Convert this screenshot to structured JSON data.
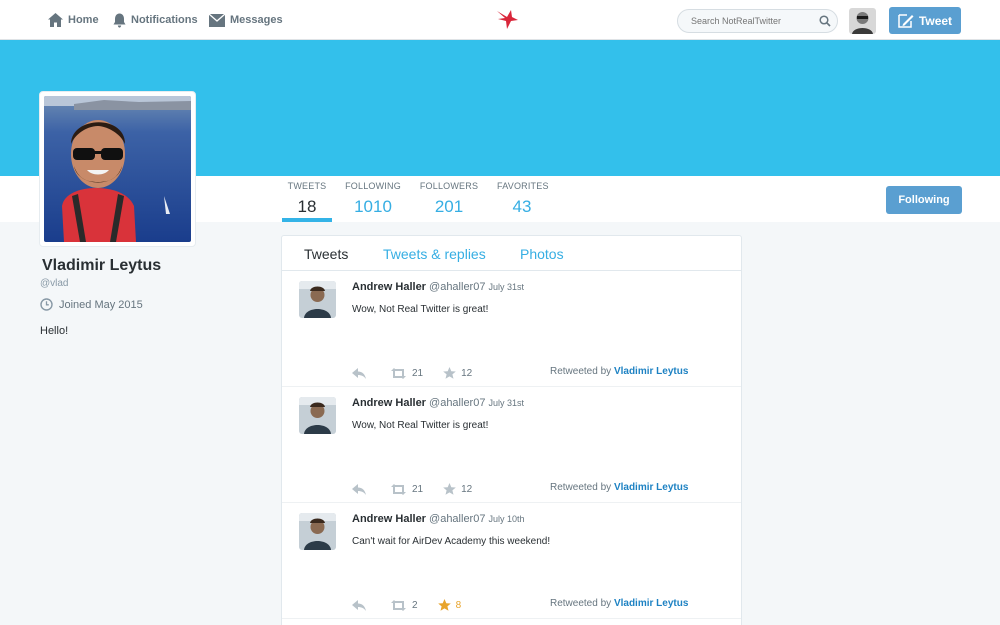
{
  "nav": {
    "home": "Home",
    "notifications": "Notifications",
    "messages": "Messages"
  },
  "search": {
    "placeholder": "Search NotRealTwitter"
  },
  "tweet_button": "Tweet",
  "profile": {
    "name": "Vladimir Leytus",
    "handle": "@vlad",
    "joined": "Joined May 2015",
    "bio": "Hello!"
  },
  "stats": [
    {
      "label": "TWEETS",
      "value": "18"
    },
    {
      "label": "FOLLOWING",
      "value": "1010"
    },
    {
      "label": "FOLLOWERS",
      "value": "201"
    },
    {
      "label": "FAVORITES",
      "value": "43"
    }
  ],
  "following_button": "Following",
  "tabs": [
    "Tweets",
    "Tweets & replies",
    "Photos"
  ],
  "retweeted_by_label": "Retweeted by",
  "tweets": [
    {
      "author": "Andrew Haller",
      "handle": "@ahaller07",
      "date": "July 31st",
      "text": "Wow, Not Real Twitter is great!",
      "retweets": "21",
      "favorites": "12",
      "favorited": false,
      "retweeted_by": "Vladimir Leytus"
    },
    {
      "author": "Andrew Haller",
      "handle": "@ahaller07",
      "date": "July 31st",
      "text": "Wow, Not Real Twitter is great!",
      "retweets": "21",
      "favorites": "12",
      "favorited": false,
      "retweeted_by": "Vladimir Leytus"
    },
    {
      "author": "Andrew Haller",
      "handle": "@ahaller07",
      "date": "July 10th",
      "text": "Can't wait for AirDev Academy this weekend!",
      "retweets": "2",
      "favorites": "8",
      "favorited": true,
      "retweeted_by": "Vladimir Leytus"
    }
  ],
  "colors": {
    "banner": "#33c0eb",
    "accent": "#36aee3",
    "button": "#5a9fd1",
    "favorite_active": "#e8a42b",
    "logo": "#d9263a"
  },
  "icons": {
    "home": "home-icon",
    "notifications": "bell-icon",
    "messages": "envelope-icon",
    "logo": "bird-logo-icon",
    "search": "search-icon",
    "compose": "compose-icon",
    "joined": "clock-icon",
    "reply": "reply-icon",
    "retweet": "retweet-icon",
    "favorite": "star-icon"
  }
}
